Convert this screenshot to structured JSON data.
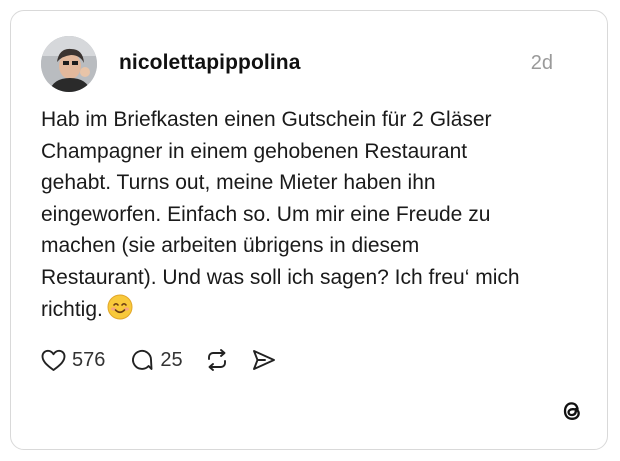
{
  "post": {
    "username": "nicolettapippolina",
    "timestamp": "2d",
    "text": "Hab im Briefkasten einen Gutschein für 2 Gläser\nChampagner in einem gehobenen Restaurant\ngehabt. Turns out, meine Mieter haben ihn\neingeworfen. Einfach so. Um mir eine Freude zu\nmachen (sie arbeiten übrigens in diesem\nRestaurant). Und was soll ich sagen? Ich freu‘ mich\nrichtig.",
    "emoji": "smiling-face-with-smiling-eyes"
  },
  "actions": {
    "likes": "576",
    "replies": "25",
    "repost_icon": "repost-icon",
    "share_icon": "send-icon"
  },
  "branding": {
    "logo": "threads-logo"
  },
  "colors": {
    "card_border": "#d9d9d9",
    "text": "#1a1a1a",
    "timestamp": "#9a9a9a",
    "emoji_face": "#f8c93b"
  }
}
